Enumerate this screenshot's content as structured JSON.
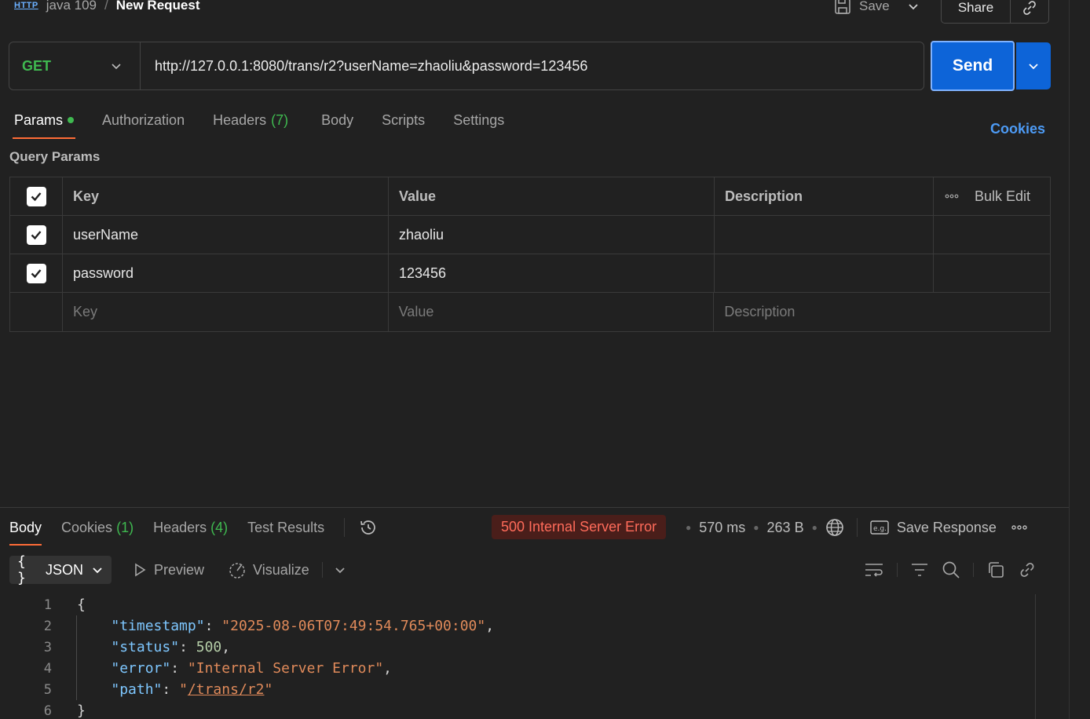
{
  "breadcrumb": {
    "badge": "HTTP",
    "collection": "java 109",
    "separator": "/",
    "title": "New Request"
  },
  "header": {
    "save_label": "Save",
    "share_label": "Share"
  },
  "request": {
    "method": "GET",
    "url": "http://127.0.0.1:8080/trans/r2?userName=zhaoliu&password=123456",
    "send_label": "Send"
  },
  "request_tabs": [
    {
      "label": "Params",
      "active": true
    },
    {
      "label": "Authorization"
    },
    {
      "label": "Headers",
      "count": "(7)"
    },
    {
      "label": "Body"
    },
    {
      "label": "Scripts"
    },
    {
      "label": "Settings"
    }
  ],
  "cookies_link": "Cookies",
  "query_params": {
    "title": "Query Params",
    "columns": [
      "Key",
      "Value",
      "Description"
    ],
    "bulk_edit": "Bulk Edit",
    "rows": [
      {
        "key": "userName",
        "value": "zhaoliu",
        "description": "",
        "checked": true
      },
      {
        "key": "password",
        "value": "123456",
        "description": "",
        "checked": true
      }
    ],
    "placeholders": {
      "key": "Key",
      "value": "Value",
      "description": "Description"
    }
  },
  "response_tabs": [
    {
      "label": "Body",
      "active": true
    },
    {
      "label": "Cookies",
      "count": "(1)"
    },
    {
      "label": "Headers",
      "count": "(4)"
    },
    {
      "label": "Test Results"
    }
  ],
  "response_status": {
    "status": "500 Internal Server Error",
    "time": "570 ms",
    "size": "263 B",
    "save_response": "Save Response"
  },
  "response_view": {
    "format": "JSON",
    "preview": "Preview",
    "visualize": "Visualize"
  },
  "response_body": {
    "line_numbers": [
      "1",
      "2",
      "3",
      "4",
      "5",
      "6"
    ],
    "timestamp_key": "\"timestamp\"",
    "timestamp_value": "\"2025-08-06T07:49:54.765+00:00\"",
    "status_key": "\"status\"",
    "status_value": "500",
    "error_key": "\"error\"",
    "error_value": "\"Internal Server Error\"",
    "path_key": "\"path\"",
    "path_value": "/trans/r2"
  },
  "colors": {
    "accent": "#0d64d8",
    "method": "#3fb950",
    "error": "#ff6b5a",
    "tab_underline": "#ff6c37",
    "link": "#4d9bf5"
  }
}
